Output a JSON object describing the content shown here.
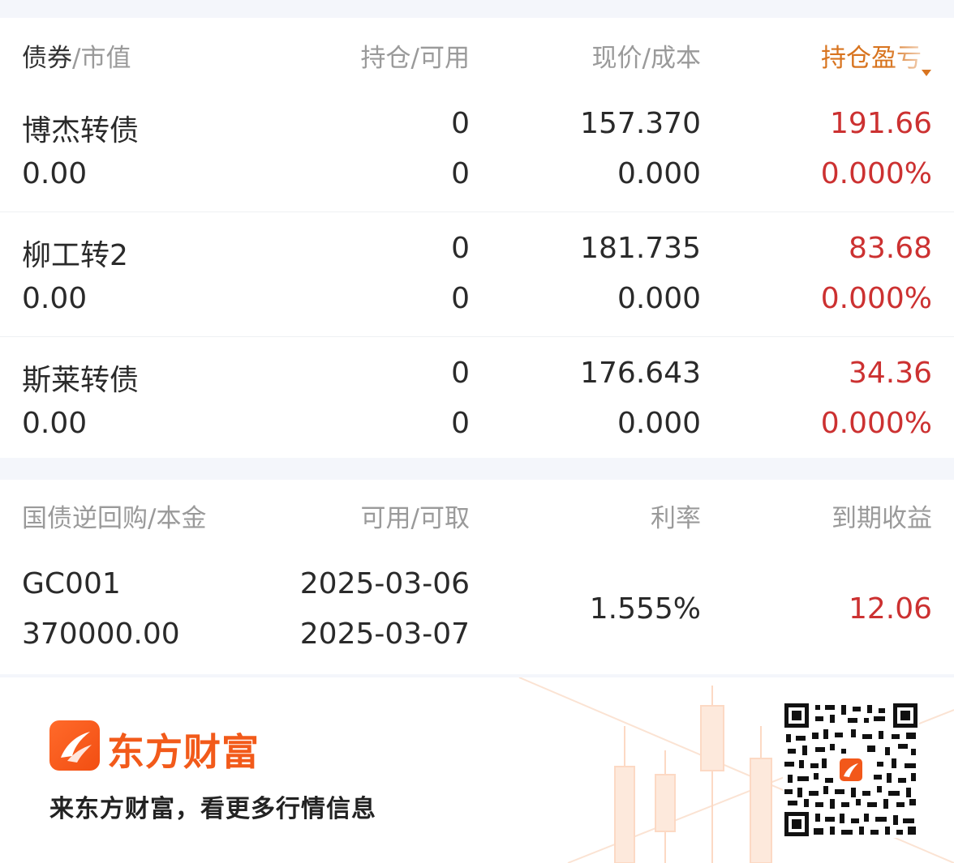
{
  "bond_table": {
    "header": {
      "col1_primary": "债券",
      "col1_secondary": "/市值",
      "col2": "持仓/可用",
      "col3": "现价/成本",
      "col4": "持仓盈亏"
    },
    "rows": [
      {
        "name": "博杰转债",
        "market_value": "0.00",
        "position": "0",
        "available": "0",
        "price": "157.370",
        "cost": "0.000",
        "pnl": "191.66",
        "pnl_pct": "0.000%"
      },
      {
        "name": "柳工转2",
        "market_value": "0.00",
        "position": "0",
        "available": "0",
        "price": "181.735",
        "cost": "0.000",
        "pnl": "83.68",
        "pnl_pct": "0.000%"
      },
      {
        "name": "斯莱转债",
        "market_value": "0.00",
        "position": "0",
        "available": "0",
        "price": "176.643",
        "cost": "0.000",
        "pnl": "34.36",
        "pnl_pct": "0.000%"
      }
    ]
  },
  "repo_table": {
    "header": {
      "col1": "国债逆回购/本金",
      "col2": "可用/可取",
      "col3": "利率",
      "col4": "到期收益"
    },
    "rows": [
      {
        "code": "GC001",
        "principal": "370000.00",
        "available_date": "2025-03-06",
        "withdraw_date": "2025-03-07",
        "rate": "1.555%",
        "income": "12.06"
      }
    ]
  },
  "footer": {
    "brand": "东方财富",
    "slogan": "来东方财富，看更多行情信息",
    "icons": [
      "eastmoney-logo-icon",
      "qr-code"
    ]
  },
  "colors": {
    "gain": "#cc3131",
    "accent": "#d8741f",
    "brand": "#f25a1a"
  }
}
